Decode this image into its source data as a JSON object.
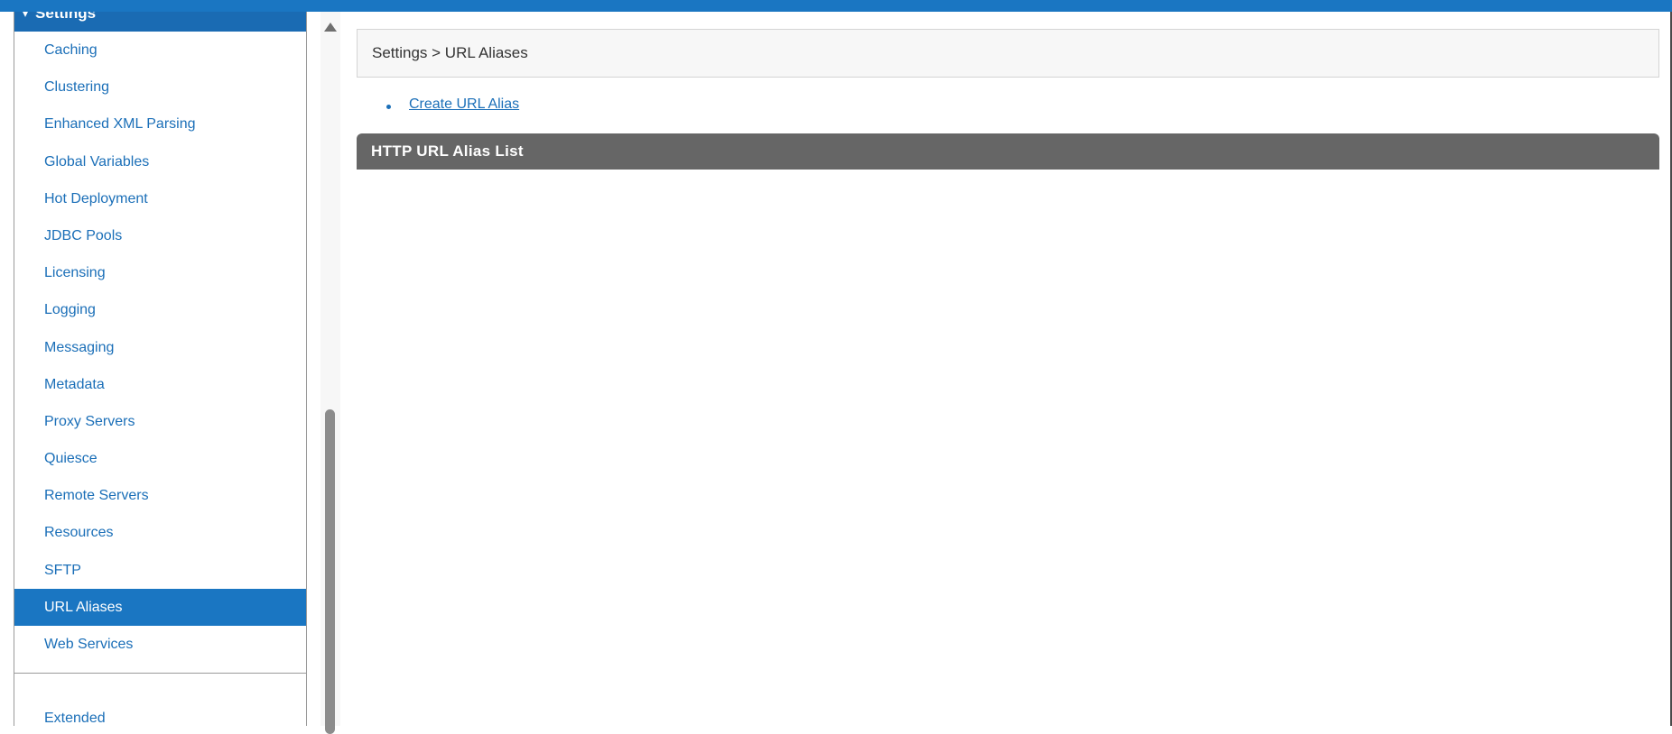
{
  "colors": {
    "topbar": "#1a76c2",
    "link": "#1b6fb8",
    "active_item_bg": "#1a76c2",
    "list_header_bg": "#666666"
  },
  "sidebar": {
    "section_title": "Settings",
    "section_icon": "chevron-down-icon",
    "items": [
      {
        "label": "Caching"
      },
      {
        "label": "Clustering"
      },
      {
        "label": "Enhanced XML Parsing"
      },
      {
        "label": "Global Variables"
      },
      {
        "label": "Hot Deployment"
      },
      {
        "label": "JDBC Pools"
      },
      {
        "label": "Licensing"
      },
      {
        "label": "Logging"
      },
      {
        "label": "Messaging"
      },
      {
        "label": "Metadata"
      },
      {
        "label": "Proxy Servers"
      },
      {
        "label": "Quiesce"
      },
      {
        "label": "Remote Servers"
      },
      {
        "label": "Resources"
      },
      {
        "label": "SFTP"
      },
      {
        "label": "URL Aliases",
        "active": true
      },
      {
        "label": "Web Services"
      }
    ],
    "extended_label": "Extended"
  },
  "main": {
    "breadcrumb": "Settings > URL Aliases",
    "create_link": "Create URL Alias",
    "list_title": "HTTP URL Alias List"
  }
}
